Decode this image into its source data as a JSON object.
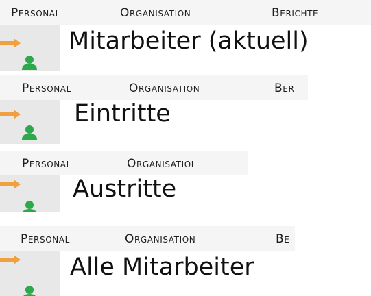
{
  "screens": [
    {
      "menu": [
        "Personal",
        "Organisation",
        "Berichte"
      ],
      "title": "Mitarbeiter (aktuell)"
    },
    {
      "menu": [
        "Personal",
        "Organisation",
        "Ber"
      ],
      "title": "Eintritte"
    },
    {
      "menu": [
        "Personal",
        "Organisatioi"
      ],
      "title": "Austritte"
    },
    {
      "menu": [
        "Personal",
        "Organisation",
        "Be"
      ],
      "title": "Alle Mitarbeiter"
    }
  ],
  "icons": {
    "arrow": "arrow-right-icon",
    "avatar": "user-icon"
  },
  "colors": {
    "arrow": "#f0a040",
    "avatar": "#2da84a",
    "menubar": "#f5f5f5",
    "sidebar": "#e8e8e8"
  }
}
